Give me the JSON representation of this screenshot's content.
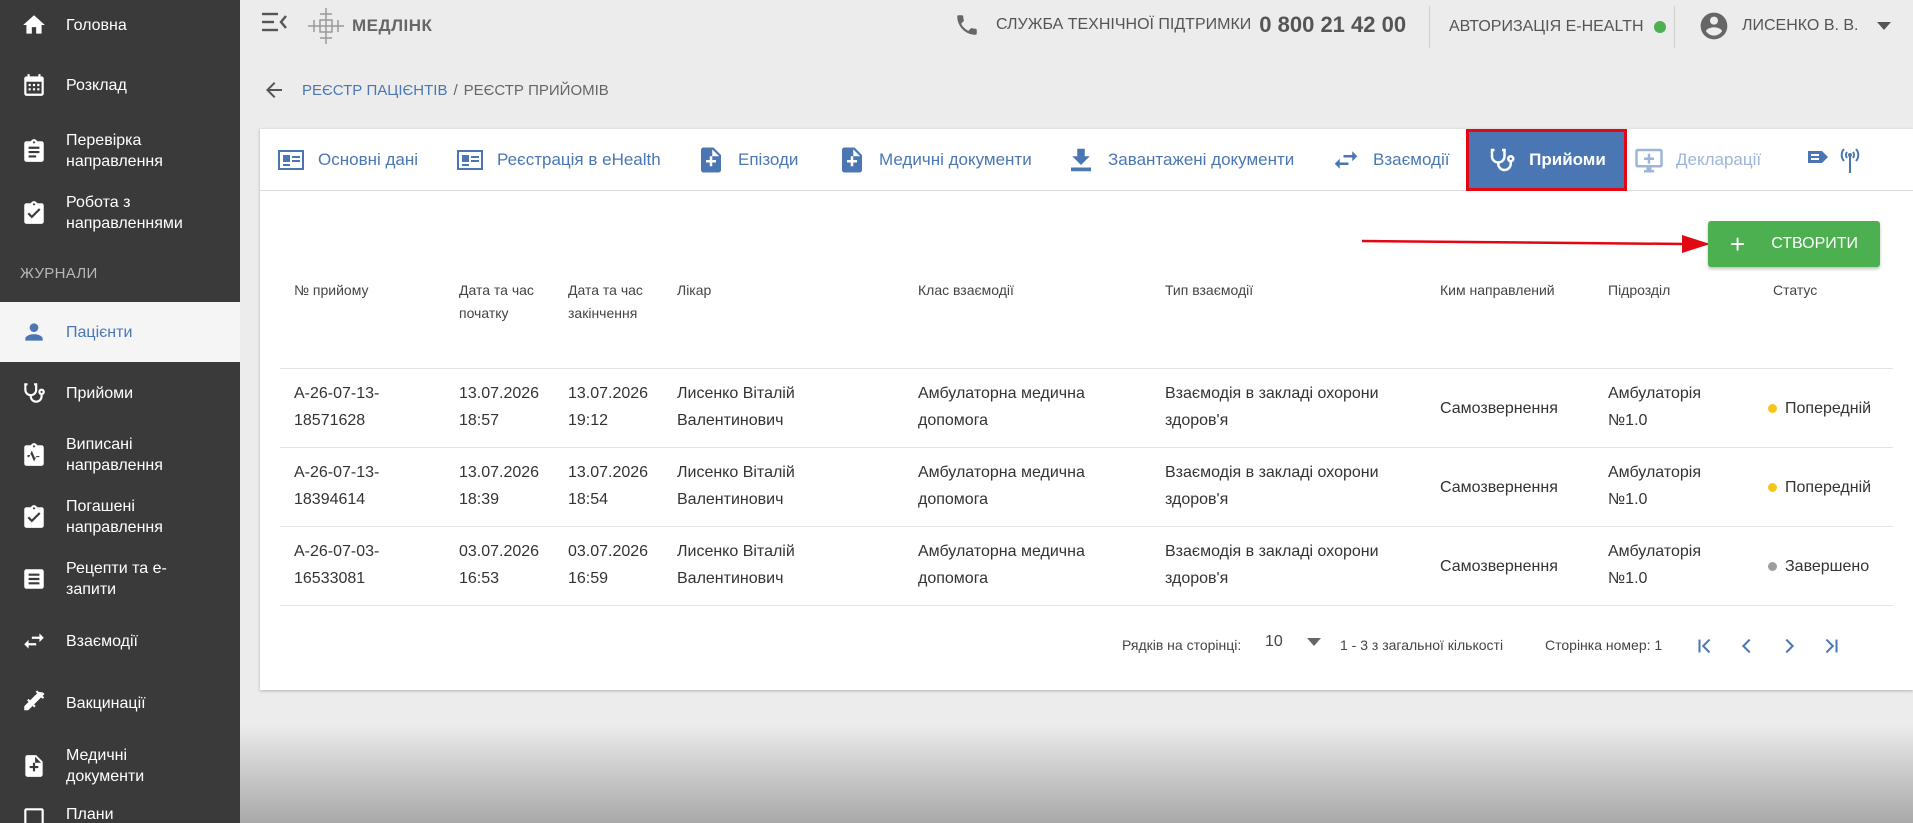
{
  "sidebar": {
    "items": [
      {
        "label": "Головна",
        "icon": "home-icon"
      },
      {
        "label": "Розклад",
        "icon": "calendar-icon"
      },
      {
        "label": "Перевірка\nнаправлення",
        "icon": "clipboard-icon"
      },
      {
        "label": "Робота з\nнаправленнями",
        "icon": "clipboard-check-icon"
      }
    ],
    "section_label": "ЖУРНАЛИ",
    "journal_items": [
      {
        "label": "Пацієнти",
        "icon": "person-icon"
      },
      {
        "label": "Прийоми",
        "icon": "stethoscope-icon"
      },
      {
        "label": "Виписані\nнаправлення",
        "icon": "clipboard-pulse-icon"
      },
      {
        "label": "Погашені\nнаправлення",
        "icon": "clipboard-check-icon"
      },
      {
        "label": "Рецепти та е-\nзапити",
        "icon": "list-icon"
      },
      {
        "label": "Взаємодії",
        "icon": "swap-icon"
      },
      {
        "label": "Вакцинації",
        "icon": "syringe-icon"
      },
      {
        "label": "Медичні\nдокументи",
        "icon": "medical-file-icon"
      },
      {
        "label": "Плани",
        "icon": "plan-icon"
      }
    ]
  },
  "header": {
    "logo_text": "МЕДЛІНК",
    "support_label": "СЛУЖБА ТЕХНІЧНОЇ ПІДТРИМКИ",
    "support_phone": "0 800 21 42 00",
    "ehealth_label": "АВТОРИЗАЦІЯ E-HEALTH",
    "ehealth_status_color": "#4caf50",
    "user_name": "ЛИСЕНКО В. В."
  },
  "breadcrumb": {
    "parent": "РЕЄСТР ПАЦІЄНТІВ",
    "separator": "/",
    "current": "РЕЄСТР ПРИЙОМІВ"
  },
  "tabs": [
    {
      "label": "Основні дані",
      "icon": "id-card-icon"
    },
    {
      "label": "Реєстрація в eHealth",
      "icon": "id-card-icon"
    },
    {
      "label": "Епізоди",
      "icon": "medical-file-icon"
    },
    {
      "label": "Медичні документи",
      "icon": "medical-file-icon"
    },
    {
      "label": "Завантажені документи",
      "icon": "download-icon"
    },
    {
      "label": "Взаємодії",
      "icon": "swap-icon"
    },
    {
      "label": "Прийоми",
      "icon": "stethoscope-icon"
    },
    {
      "label": "Декларації",
      "icon": "monitor-plus-icon"
    },
    {
      "label": "",
      "icon": "signal-icon"
    }
  ],
  "create_button_label": "СТВОРИТИ",
  "table": {
    "columns": [
      "№ прийому",
      "Дата та час\nпочатку",
      "Дата та час\nзакінчення",
      "Лікар",
      "Клас взаємодії",
      "Тип взаємодії",
      "Ким направлений",
      "Підрозділ",
      "Статус"
    ],
    "rows": [
      {
        "number": "А-26-07-13-\n18571628",
        "start": "13.07.2026\n18:57",
        "end": "13.07.2026\n19:12",
        "doctor": "Лисенко Віталій\nВалентинович",
        "class": "Амбулаторна медична\nдопомога",
        "type": "Взаємодія в закладі охорони\nздоров'я",
        "referred_by": "Самозвернення",
        "unit": "Амбулаторія\n№1.0",
        "status": "Попередній",
        "status_color": "#f5c518"
      },
      {
        "number": "А-26-07-13-\n18394614",
        "start": "13.07.2026\n18:39",
        "end": "13.07.2026\n18:54",
        "doctor": "Лисенко Віталій\nВалентинович",
        "class": "Амбулаторна медична\nдопомога",
        "type": "Взаємодія в закладі охорони\nздоров'я",
        "referred_by": "Самозвернення",
        "unit": "Амбулаторія\n№1.0",
        "status": "Попередній",
        "status_color": "#f5c518"
      },
      {
        "number": "А-26-07-03-\n16533081",
        "start": "03.07.2026\n16:53",
        "end": "03.07.2026\n16:59",
        "doctor": "Лисенко Віталій\nВалентинович",
        "class": "Амбулаторна медична\nдопомога",
        "type": "Взаємодія в закладі охорони\nздоров'я",
        "referred_by": "Самозвернення",
        "unit": "Амбулаторія\n№1.0",
        "status": "Завершено",
        "status_color": "#9e9e9e"
      }
    ]
  },
  "pagination": {
    "rows_per_page_label": "Рядків на сторінці:",
    "rows_per_page_value": "10",
    "range_label": "1 - 3 з загальної кількості",
    "page_label": "Сторінка номер: 1"
  },
  "colors": {
    "accent": "#4a77b4",
    "sidebar_bg": "#3a3a3a",
    "create_button": "#4caf50",
    "highlight_border": "#e30613"
  }
}
